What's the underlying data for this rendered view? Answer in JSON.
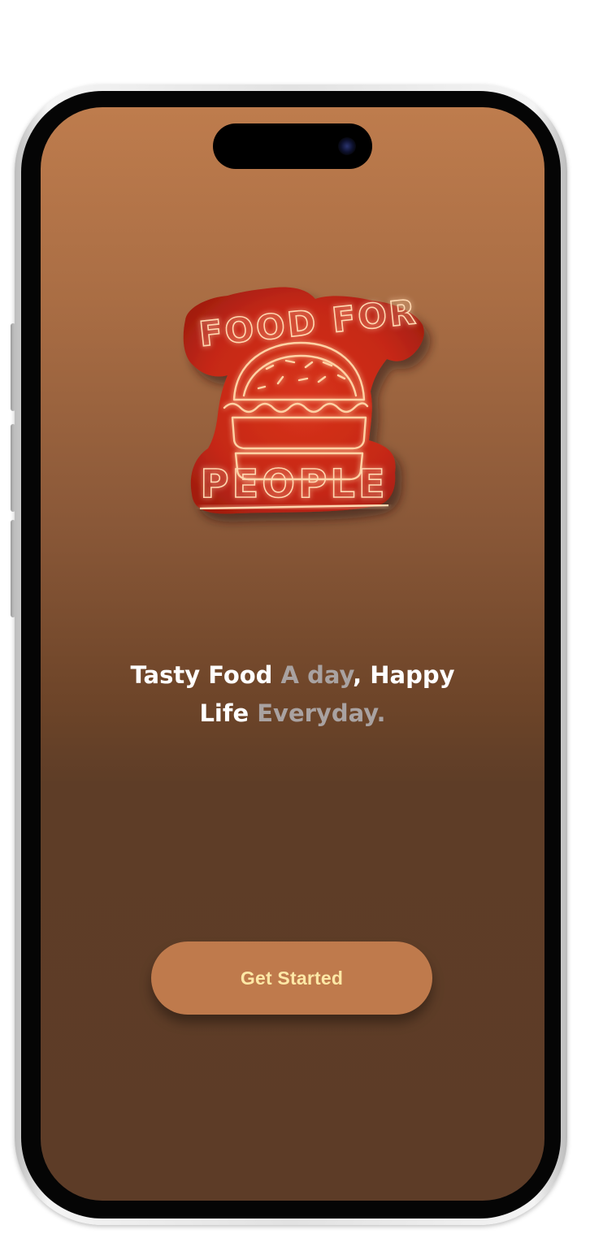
{
  "logo": {
    "line1": "FOOD FOR",
    "line2": "PEOPLE",
    "icon": "burger-neon-icon"
  },
  "tagline": {
    "part1": "Tasty Food ",
    "part2": "A day",
    "part3": ", Happy",
    "part4": "Life ",
    "part5": "Everyday."
  },
  "cta": {
    "label": "Get Started"
  },
  "colors": {
    "background_top": "#be7c4d",
    "background_bottom": "#5d3c27",
    "button_bg": "#bf7a4c",
    "button_text": "#fde8a6",
    "text_primary": "#ffffff",
    "text_muted": "#a9a2a1",
    "neon_red": "#e63a1c"
  }
}
